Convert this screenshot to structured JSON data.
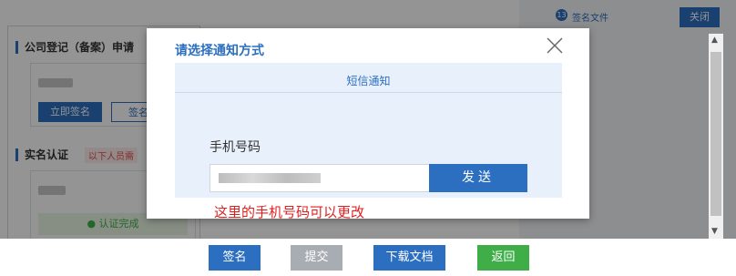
{
  "background": {
    "left_section_title": "公司登记（备案）申请",
    "sign_now_button": "立即签名",
    "sign_button_secondary": "签名",
    "realname_title": "实名认证",
    "realname_tag": "以下人员需",
    "auth_complete": "认证完成",
    "sign_file_label": "签名文件",
    "sign_file_badge": "13",
    "close_button": "关闭"
  },
  "footer": {
    "sign": "签名",
    "submit": "提交",
    "download": "下载文档",
    "back": "返回"
  },
  "modal": {
    "title": "请选择通知方式",
    "notice_title": "短信通知",
    "phone_label": "手机号码",
    "phone_placeholder": "",
    "send_button": "发送",
    "hint": "这里的手机号码可以更改"
  },
  "colors": {
    "primary": "#2c6fc0",
    "success": "#3fae49",
    "disabled": "#a8adb4",
    "error": "#e01f1f"
  }
}
